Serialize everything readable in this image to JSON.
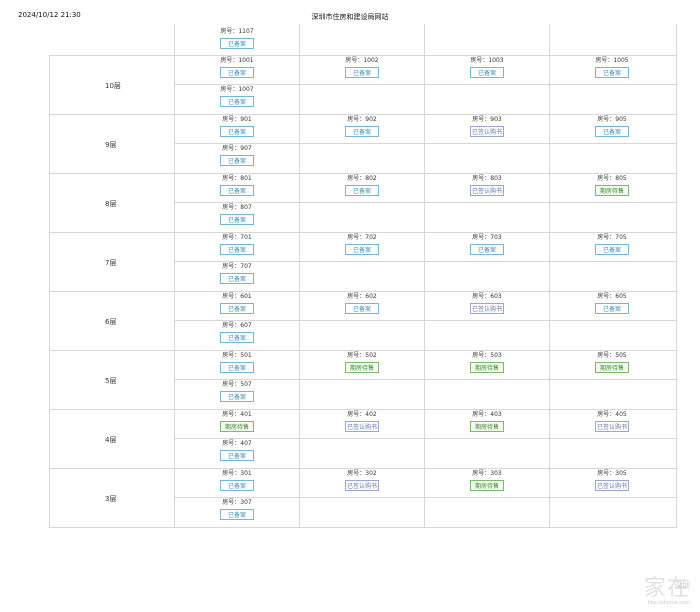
{
  "header": {
    "timestamp": "2024/10/12 21:30",
    "site_title": "深圳市住房和建设局网站"
  },
  "room_prefix": "房号：",
  "statuses": {
    "recorded": "已备案",
    "signed": "已签认购书",
    "for_sale": "期房待售"
  },
  "top_partial": {
    "room": "1107",
    "status": "recorded"
  },
  "floors": [
    {
      "label": "10层",
      "row1": [
        {
          "room": "1001",
          "status": "recorded"
        },
        {
          "room": "1002",
          "status": "recorded"
        },
        {
          "room": "1003",
          "status": "recorded"
        },
        {
          "room": "1005",
          "status": "recorded"
        }
      ],
      "row2": {
        "room": "1007",
        "status": "recorded"
      }
    },
    {
      "label": "9层",
      "row1": [
        {
          "room": "901",
          "status": "recorded"
        },
        {
          "room": "902",
          "status": "recorded"
        },
        {
          "room": "903",
          "status": "signed"
        },
        {
          "room": "905",
          "status": "recorded"
        }
      ],
      "row2": {
        "room": "907",
        "status": "recorded"
      }
    },
    {
      "label": "8层",
      "row1": [
        {
          "room": "801",
          "status": "recorded"
        },
        {
          "room": "802",
          "status": "recorded"
        },
        {
          "room": "803",
          "status": "signed"
        },
        {
          "room": "805",
          "status": "for_sale"
        }
      ],
      "row2": {
        "room": "807",
        "status": "recorded"
      }
    },
    {
      "label": "7层",
      "row1": [
        {
          "room": "701",
          "status": "recorded"
        },
        {
          "room": "702",
          "status": "recorded"
        },
        {
          "room": "703",
          "status": "recorded"
        },
        {
          "room": "705",
          "status": "recorded"
        }
      ],
      "row2": {
        "room": "707",
        "status": "recorded"
      }
    },
    {
      "label": "6层",
      "row1": [
        {
          "room": "601",
          "status": "recorded"
        },
        {
          "room": "602",
          "status": "recorded"
        },
        {
          "room": "603",
          "status": "signed"
        },
        {
          "room": "605",
          "status": "recorded"
        }
      ],
      "row2": {
        "room": "607",
        "status": "recorded"
      }
    },
    {
      "label": "5层",
      "row1": [
        {
          "room": "501",
          "status": "recorded"
        },
        {
          "room": "502",
          "status": "for_sale"
        },
        {
          "room": "503",
          "status": "for_sale"
        },
        {
          "room": "505",
          "status": "for_sale"
        }
      ],
      "row2": {
        "room": "507",
        "status": "recorded"
      }
    },
    {
      "label": "4层",
      "row1": [
        {
          "room": "401",
          "status": "for_sale"
        },
        {
          "room": "402",
          "status": "signed"
        },
        {
          "room": "403",
          "status": "for_sale"
        },
        {
          "room": "405",
          "status": "signed"
        }
      ],
      "row2": {
        "room": "407",
        "status": "recorded"
      }
    },
    {
      "label": "3层",
      "row1": [
        {
          "room": "301",
          "status": "recorded"
        },
        {
          "room": "302",
          "status": "signed"
        },
        {
          "room": "303",
          "status": "for_sale"
        },
        {
          "room": "305",
          "status": "signed"
        }
      ],
      "row2": {
        "room": "307",
        "status": "recorded"
      }
    }
  ],
  "watermark": {
    "main": "家在",
    "sub": "深圳",
    "url": "bbs.szhome.com"
  },
  "colors": {
    "recorded": "#3f8fb8",
    "signed": "#6676a8",
    "for_sale": "#3e8a2e",
    "grid": "#d7d7d7"
  }
}
